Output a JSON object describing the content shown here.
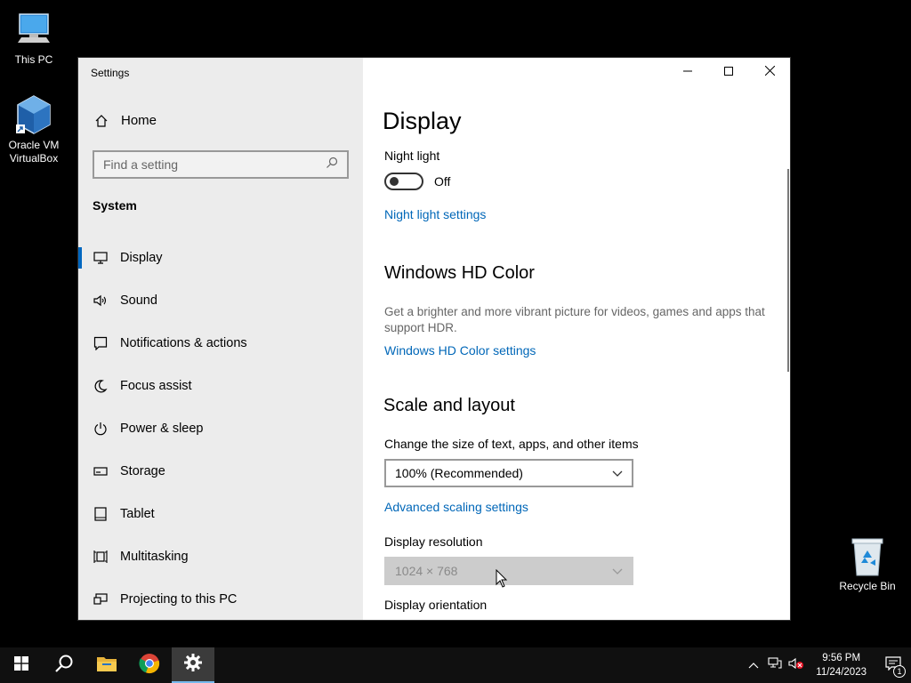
{
  "desktop": {
    "icons": [
      {
        "label": "This PC"
      },
      {
        "label": "Oracle VM VirtualBox"
      },
      {
        "label": "Recycle Bin"
      }
    ]
  },
  "window": {
    "title": "Settings",
    "controls": {
      "minimize": "minimize-icon",
      "maximize": "maximize-icon",
      "close": "close-icon"
    }
  },
  "sidebar": {
    "home_label": "Home",
    "search_placeholder": "Find a setting",
    "group_label": "System",
    "items": [
      {
        "label": "Display",
        "icon": "monitor-icon",
        "active": true
      },
      {
        "label": "Sound",
        "icon": "speaker-icon"
      },
      {
        "label": "Notifications & actions",
        "icon": "notification-icon"
      },
      {
        "label": "Focus assist",
        "icon": "moon-icon"
      },
      {
        "label": "Power & sleep",
        "icon": "power-icon"
      },
      {
        "label": "Storage",
        "icon": "storage-icon"
      },
      {
        "label": "Tablet",
        "icon": "tablet-icon"
      },
      {
        "label": "Multitasking",
        "icon": "multitasking-icon"
      },
      {
        "label": "Projecting to this PC",
        "icon": "projecting-icon"
      }
    ]
  },
  "content": {
    "title": "Display",
    "night_light": {
      "label": "Night light",
      "state": "Off",
      "settings_link": "Night light settings"
    },
    "hd_color": {
      "heading": "Windows HD Color",
      "description": "Get a brighter and more vibrant picture for videos, games and apps that support HDR.",
      "settings_link": "Windows HD Color settings"
    },
    "scale_layout": {
      "heading": "Scale and layout",
      "size_label": "Change the size of text, apps, and other items",
      "size_value": "100% (Recommended)",
      "advanced_link": "Advanced scaling settings",
      "resolution_label": "Display resolution",
      "resolution_value": "1024 × 768",
      "orientation_label": "Display orientation"
    }
  },
  "taskbar": {
    "apps": [
      "start-icon",
      "search-icon",
      "file-explorer-icon",
      "chrome-icon",
      "settings-icon"
    ],
    "clock_time": "9:56 PM",
    "clock_date": "11/24/2023",
    "notification_count": "1"
  },
  "colors": {
    "accent": "#0067c0",
    "link": "#0067b8",
    "sidebar_bg": "#ececec",
    "taskbar_bg": "#101010"
  }
}
